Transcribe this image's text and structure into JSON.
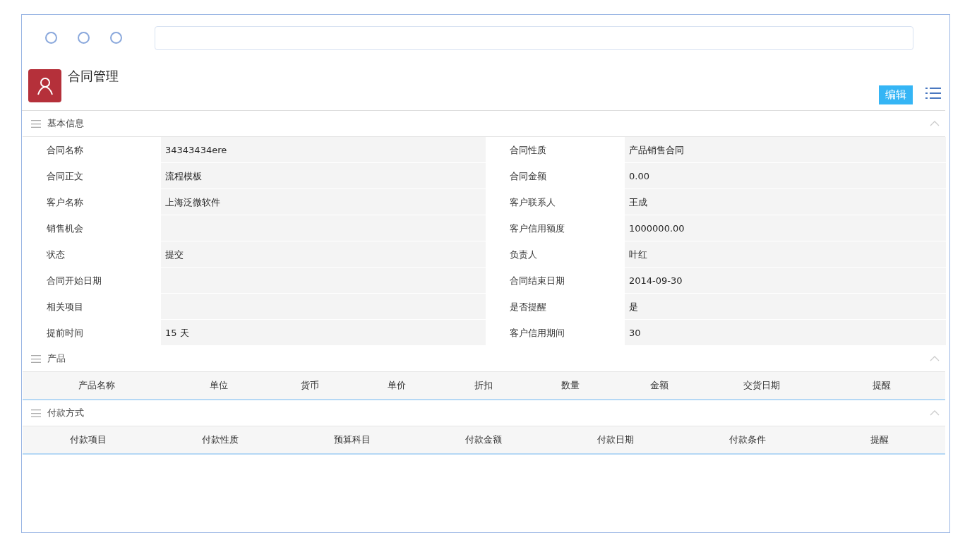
{
  "header": {
    "title": "合同管理",
    "edit_button": "编辑"
  },
  "sections": [
    {
      "kind": "fields",
      "title": "基本信息",
      "expanded": true,
      "fields": [
        {
          "label": "合同名称",
          "value": "34343434ere"
        },
        {
          "label": "合同性质",
          "value": "产品销售合同"
        },
        {
          "label": "合同正文",
          "value": "流程模板"
        },
        {
          "label": "合同金额",
          "value": "0.00"
        },
        {
          "label": "客户名称",
          "value": "上海泛微软件"
        },
        {
          "label": "客户联系人",
          "value": "王成"
        },
        {
          "label": "销售机会"
        },
        {
          "label": "客户信用额度",
          "value": "1000000.00"
        },
        {
          "label": "状态",
          "value": "提交"
        },
        {
          "label": "负责人",
          "value": "叶红"
        },
        {
          "label": "合同开始日期"
        },
        {
          "label": "合同结束日期",
          "value": "2014-09-30"
        },
        {
          "label": "相关项目"
        },
        {
          "label": "是否提醒",
          "value": "是"
        },
        {
          "label": "提前时间",
          "value": "15 天"
        },
        {
          "label": "客户信用期间",
          "value": "30"
        }
      ]
    },
    {
      "kind": "table",
      "title": "产品",
      "expanded": true,
      "columns": [
        "产品名称",
        "单位",
        "货币",
        "单价",
        "折扣",
        "数量",
        "金额",
        "交货日期",
        "提醒"
      ]
    },
    {
      "kind": "table",
      "title": "付款方式",
      "expanded": true,
      "columns": [
        "付款项目",
        "付款性质",
        "预算科目",
        "付款金额",
        "付款日期",
        "付款条件",
        "提醒"
      ]
    }
  ]
}
